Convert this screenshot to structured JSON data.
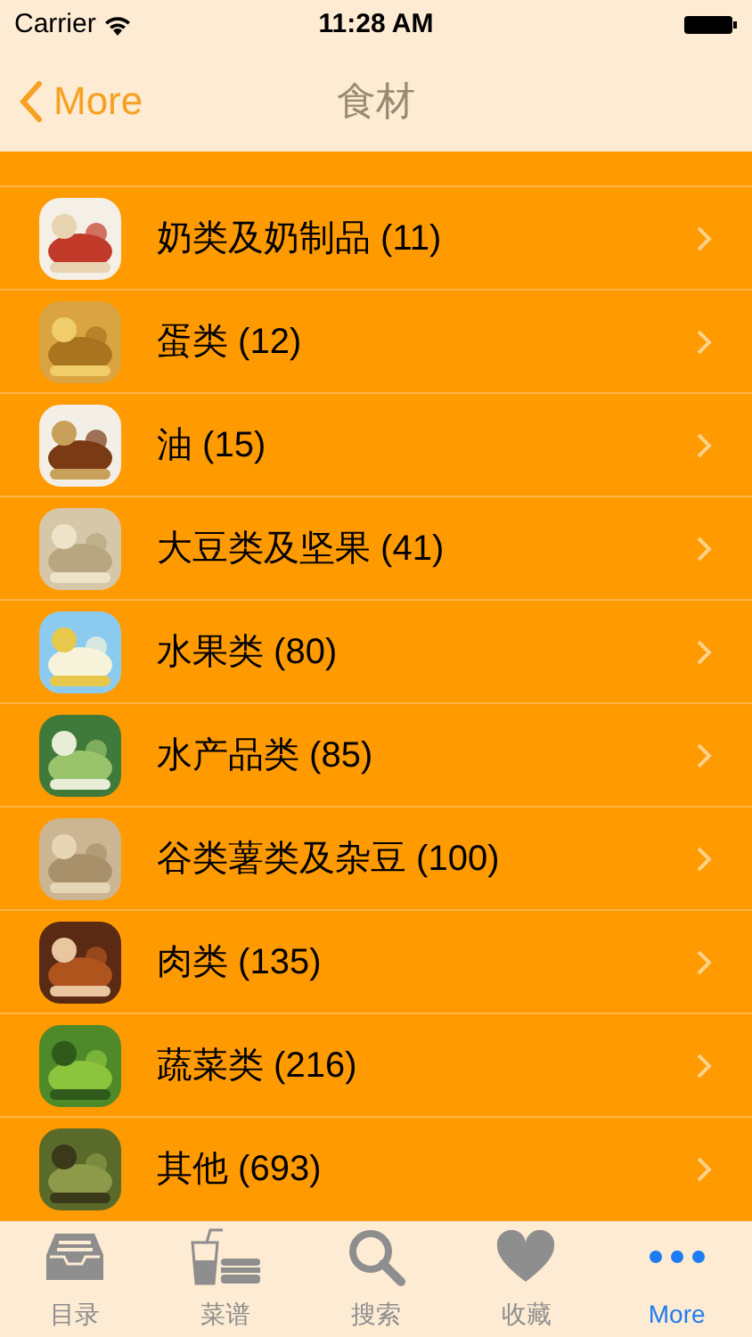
{
  "status_bar": {
    "carrier": "Carrier",
    "time": "11:28 AM"
  },
  "nav": {
    "back": "More",
    "title": "食材"
  },
  "items": [
    {
      "label": "奶类及奶制品 (11)"
    },
    {
      "label": "蛋类 (12)"
    },
    {
      "label": "油 (15)"
    },
    {
      "label": "大豆类及坚果 (41)"
    },
    {
      "label": "水果类 (80)"
    },
    {
      "label": "水产品类 (85)"
    },
    {
      "label": "谷类薯类及杂豆 (100)"
    },
    {
      "label": "肉类 (135)"
    },
    {
      "label": "蔬菜类 (216)"
    },
    {
      "label": "其他 (693)"
    }
  ],
  "tabs": [
    {
      "kind": "tray",
      "label": "目录",
      "selected": false
    },
    {
      "kind": "drink",
      "label": "菜谱",
      "selected": false
    },
    {
      "kind": "search",
      "label": "搜索",
      "selected": false
    },
    {
      "kind": "heart",
      "label": "收藏",
      "selected": false
    },
    {
      "kind": "more",
      "label": "More",
      "selected": true
    }
  ]
}
